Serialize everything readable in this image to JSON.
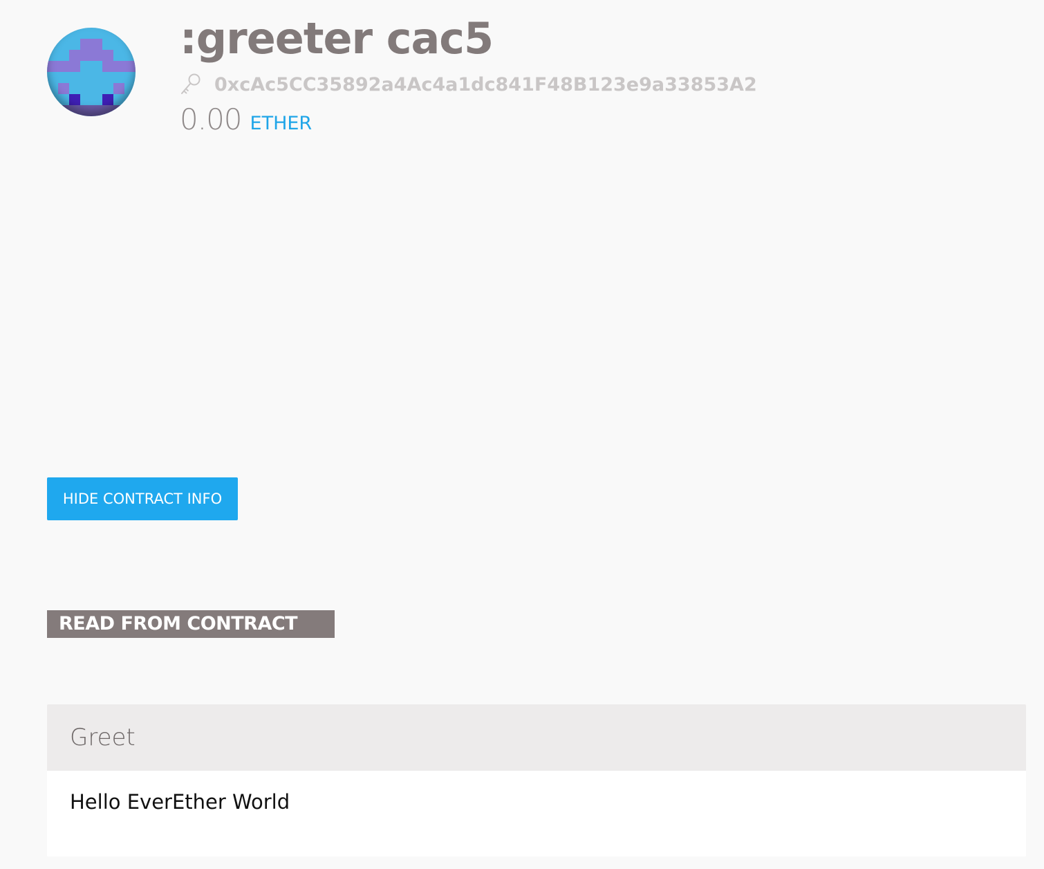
{
  "contract": {
    "name": ":greeter cac5",
    "address": "0xcAc5CC35892a4Ac4a1dc841F48B123e9a33853A2",
    "balance": "0.00",
    "unit": "ETHER"
  },
  "icons": {
    "avatar": "identicon-avatar",
    "address": "key-icon"
  },
  "colors": {
    "accent": "#1fa8ee",
    "title": "#827a7a",
    "section_badge": "#847b7b"
  },
  "actions": {
    "toggle_info_label": "HIDE CONTRACT INFO"
  },
  "read_section": {
    "heading": "READ FROM CONTRACT",
    "functions": [
      {
        "name": "Greet",
        "output": "Hello EverEther World"
      }
    ]
  }
}
